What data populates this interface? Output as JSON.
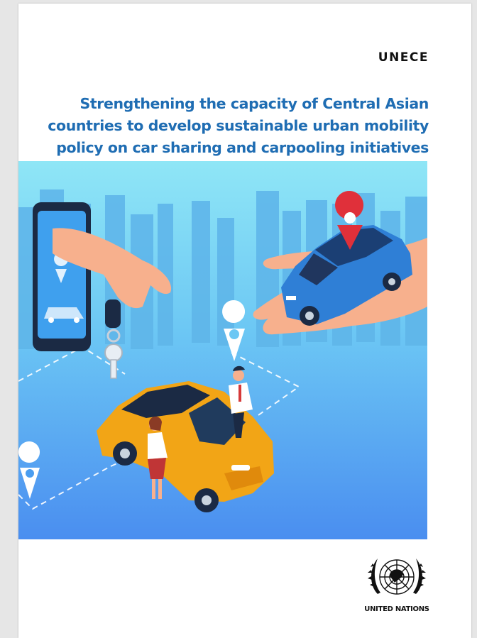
{
  "cover": {
    "org_name": "UNECE",
    "title_lines": [
      "Strengthening the capacity of Central  Asian",
      "countries to develop sustainable urban mobility",
      "policy on car sharing and carpooling initiatives"
    ],
    "publisher": "UNITED NATIONS"
  },
  "colors": {
    "title": "#1f6db3",
    "sky_top": "#8fe3f5",
    "sky_bottom": "#4a8ef0",
    "car_blue": "#2f7fd6",
    "car_yellow": "#f2a516",
    "pin_red": "#e0303a"
  },
  "icons": [
    "phone-icon",
    "map-pin-icon",
    "car-key-icon",
    "emblem-icon"
  ]
}
